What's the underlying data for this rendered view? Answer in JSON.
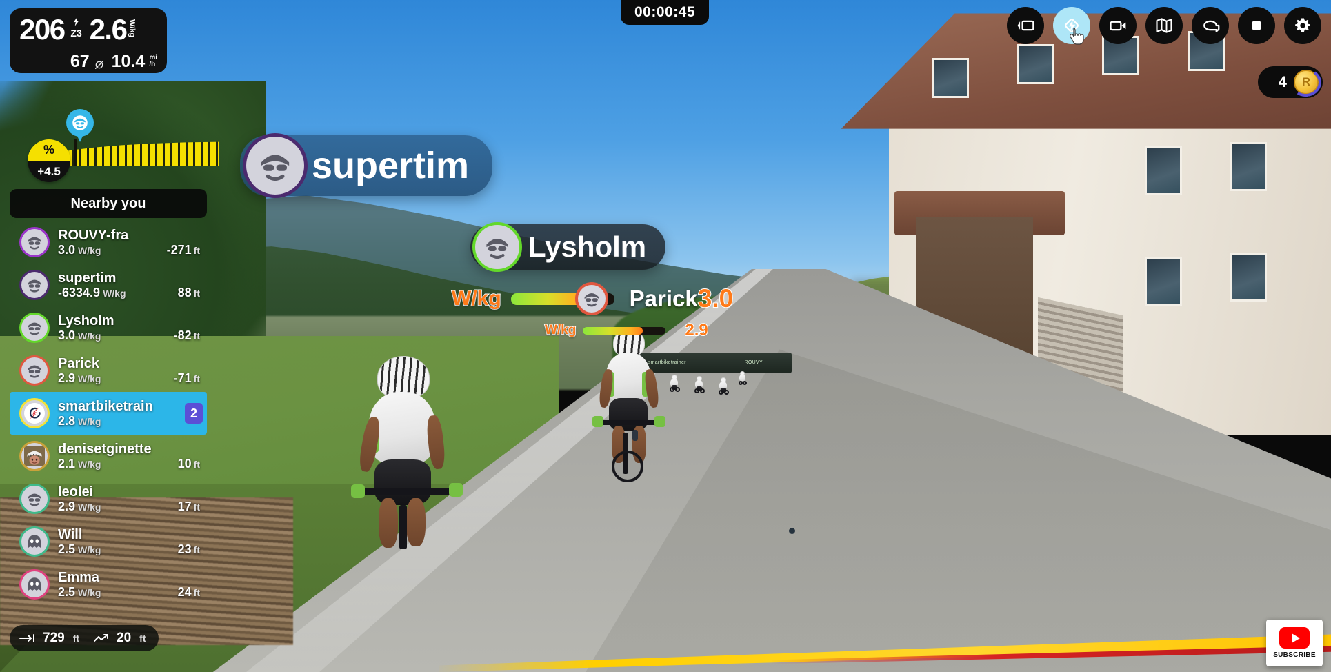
{
  "app": {
    "name": "ROUVY",
    "timer": "00:00:45"
  },
  "metrics": {
    "power": "206",
    "power_zone": "Z3",
    "bolt_icon": "lightning-icon",
    "wkg": "2.6",
    "wkg_unit": "W/kg",
    "cadence": "67",
    "cadence_icon": "cadence-icon",
    "speed": "10.4",
    "speed_unit_top": "mi",
    "speed_unit_bottom": "/h"
  },
  "profile": {
    "gradient_percent_symbol": "%",
    "gradient_value": "+4.5",
    "marker_icon": "rider-position-pin-icon"
  },
  "nearby": {
    "title": "Nearby you",
    "riders": [
      {
        "name": "ROUVY-fra",
        "wkg": "3.0",
        "unit": "W/kg",
        "gap": "-271",
        "gap_unit": "ft",
        "ring_color": "#9b35c9",
        "avatar": "face-avatar-icon",
        "highlight": false,
        "badge": ""
      },
      {
        "name": "supertim",
        "wkg": "-6334.9",
        "unit": "W/kg",
        "gap": "88",
        "gap_unit": "ft",
        "ring_color": "#4b2a6e",
        "avatar": "face-avatar-icon",
        "highlight": false,
        "badge": ""
      },
      {
        "name": "Lysholm",
        "wkg": "3.0",
        "unit": "W/kg",
        "gap": "-82",
        "gap_unit": "ft",
        "ring_color": "#63d82a",
        "avatar": "face-avatar-icon",
        "highlight": false,
        "badge": ""
      },
      {
        "name": "Parick",
        "wkg": "2.9",
        "unit": "W/kg",
        "gap": "-71",
        "gap_unit": "ft",
        "ring_color": "#e0573f",
        "avatar": "face-avatar-icon",
        "highlight": false,
        "badge": ""
      },
      {
        "name": "smartbiketrain",
        "wkg": "2.8",
        "unit": "W/kg",
        "gap": "",
        "gap_unit": "",
        "ring_color": "#f2e23a",
        "avatar": "smartbiketrain-logo-icon",
        "highlight": true,
        "badge": "2"
      },
      {
        "name": "denisetginette",
        "wkg": "2.1",
        "unit": "W/kg",
        "gap": "10",
        "gap_unit": "ft",
        "ring_color": "#caa23a",
        "avatar": "photo-avatar-icon",
        "highlight": false,
        "badge": ""
      },
      {
        "name": "leolei",
        "wkg": "2.9",
        "unit": "W/kg",
        "gap": "17",
        "gap_unit": "ft",
        "ring_color": "#3fb98a",
        "avatar": "face-avatar-icon",
        "highlight": false,
        "badge": ""
      },
      {
        "name": "Will",
        "wkg": "2.5",
        "unit": "W/kg",
        "gap": "23",
        "gap_unit": "ft",
        "ring_color": "#3fb98a",
        "avatar": "ghost-avatar-icon",
        "highlight": false,
        "badge": ""
      },
      {
        "name": "Emma",
        "wkg": "2.5",
        "unit": "W/kg",
        "gap": "24",
        "gap_unit": "ft",
        "ring_color": "#e0417f",
        "avatar": "ghost-avatar-icon",
        "highlight": false,
        "badge": ""
      }
    ]
  },
  "distance_bar": {
    "distance_value": "729",
    "distance_unit": "ft",
    "distance_icon": "distance-to-go-icon",
    "elevation_value": "20",
    "elevation_unit": "ft",
    "elevation_icon": "elevation-gain-icon"
  },
  "toolbar": {
    "buttons": [
      {
        "name": "screen-layout-icon",
        "label": "Screen layout",
        "active": false
      },
      {
        "name": "power-up-icon",
        "label": "Power-up",
        "active": true
      },
      {
        "name": "video-camera-icon",
        "label": "Camera view",
        "active": false
      },
      {
        "name": "map-icon",
        "label": "Map",
        "active": false
      },
      {
        "name": "chat-icon",
        "label": "Chat",
        "active": false
      },
      {
        "name": "stop-icon",
        "label": "End ride",
        "active": false
      },
      {
        "name": "gear-icon",
        "label": "Settings",
        "active": false
      }
    ]
  },
  "xp_badge": {
    "count": "4",
    "coin_letter": "R",
    "coin_icon": "rouvy-coin-icon"
  },
  "name_banners": [
    {
      "name": "supertim",
      "ring_color": "#4b2a6e"
    },
    {
      "name": "Lysholm",
      "ring_color": "#63d82a"
    }
  ],
  "wkg_gauges": [
    {
      "label": "W/kg",
      "rider": "Parick",
      "value": "3.0",
      "fill_percent": 78,
      "knob_ring": "#e0573f"
    },
    {
      "label": "W/kg",
      "rider": "",
      "value": "2.9",
      "fill_percent": 72,
      "knob_ring": ""
    }
  ],
  "scene": {
    "course_banner_left": "smartbiketrainer",
    "course_banner_right": "ROUVY",
    "colors": {
      "highlight_row": "#2cb6e8",
      "accent_orange": "#ff7a18",
      "badge_purple": "#5b4fd6",
      "gradient_yellow": "#f5e000"
    }
  },
  "subscribe": {
    "label": "SUBSCRIBE",
    "icon": "youtube-icon"
  }
}
